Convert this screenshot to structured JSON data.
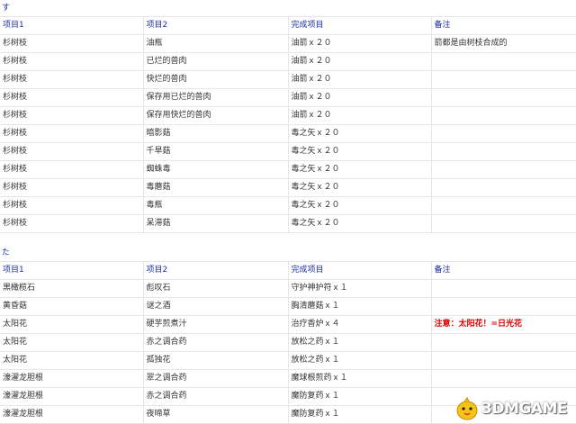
{
  "section1": {
    "label": "す",
    "headers": [
      "项目1",
      "项目2",
      "完成项目",
      "备注"
    ],
    "rows": [
      [
        "杉树枝",
        "油瓶",
        "油箭ｘ２０",
        "箭都是由树枝合成的"
      ],
      [
        "杉树枝",
        "已烂的兽肉",
        "油箭ｘ２０",
        ""
      ],
      [
        "杉树枝",
        "快烂的兽肉",
        "油箭ｘ２０",
        ""
      ],
      [
        "杉树枝",
        "保存用已烂的兽肉",
        "油箭ｘ２０",
        ""
      ],
      [
        "杉树枝",
        "保存用快烂的兽肉",
        "油箭ｘ２０",
        ""
      ],
      [
        "杉树枝",
        "暗影菇",
        "毒之矢ｘ２０",
        ""
      ],
      [
        "杉树枝",
        "千旱菇",
        "毒之矢ｘ２０",
        ""
      ],
      [
        "杉树枝",
        "蜘蛛毒",
        "毒之矢ｘ２０",
        ""
      ],
      [
        "杉树枝",
        "毒蘑菇",
        "毒之矢ｘ２０",
        ""
      ],
      [
        "杉树枝",
        "毒瓶",
        "毒之矢ｘ２０",
        ""
      ],
      [
        "杉树枝",
        "呆滞菇",
        "毒之矢ｘ２０",
        ""
      ]
    ]
  },
  "section2": {
    "label": "た",
    "headers": [
      "项目1",
      "项目2",
      "完成项目",
      "备注"
    ],
    "rows": [
      [
        "黒橄榄石",
        "彪叹石",
        "守护神护符ｘ１",
        ""
      ],
      [
        "黄昏菇",
        "谜之酒",
        "胸清蘑菇ｘ１",
        ""
      ],
      [
        "太阳花",
        "硬芋煎煮汁",
        "治疗香炉ｘ４",
        "注意：太阳花！=日光花"
      ],
      [
        "太阳花",
        "赤之调合药",
        "放松之药ｘ１",
        ""
      ],
      [
        "太阳花",
        "孤独花",
        "放松之药ｘ１",
        ""
      ],
      [
        "濠濯龙胆根",
        "翠之调合药",
        "魔球根煎药ｘ１",
        ""
      ],
      [
        "濠濯龙胆根",
        "赤之调合药",
        "魔防复药ｘ１",
        ""
      ],
      [
        "濠濯龙胆根",
        "夜啼草",
        "魔防复药ｘ１",
        ""
      ]
    ]
  },
  "watermark": {
    "text": "3DMGAME"
  }
}
